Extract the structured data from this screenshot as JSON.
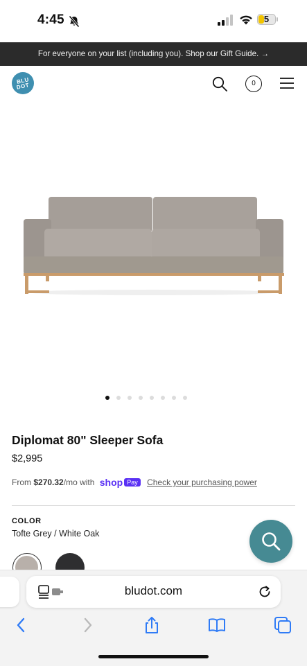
{
  "status_bar": {
    "time": "4:45",
    "battery": "5"
  },
  "promo_banner": {
    "text": "For everyone on your list (including you). Shop our Gift Guide. →"
  },
  "header": {
    "logo_line1": "BLU",
    "logo_line2": "DOT",
    "cart_count": "0"
  },
  "carousel": {
    "count": 8,
    "active_index": 0
  },
  "product": {
    "title": "Diplomat 80\" Sleeper Sofa",
    "price": "$2,995",
    "financing_prefix": "From ",
    "financing_amount": "$270.32",
    "financing_suffix": "/mo with",
    "shop_label": "shop",
    "pay_label": "Pay",
    "financing_link": "Check your purchasing power",
    "color_label": "COLOR",
    "color_value": "Tofte Grey / White Oak"
  },
  "browser": {
    "url": "bludot.com"
  },
  "colors": {
    "banner_bg": "#2b2b2b",
    "logo": "#3f8fb0",
    "chat_button": "#468a93",
    "shop_pay": "#5a31f4",
    "safari_blue": "#2f7bf6"
  },
  "icons": [
    "bell-slash-icon",
    "signal-icon",
    "wifi-icon",
    "battery-icon",
    "search-icon",
    "cart-icon",
    "menu-icon",
    "chat-search-icon",
    "reader-icon",
    "reload-icon",
    "back-icon",
    "forward-icon",
    "share-icon",
    "bookmarks-icon",
    "tabs-icon"
  ]
}
